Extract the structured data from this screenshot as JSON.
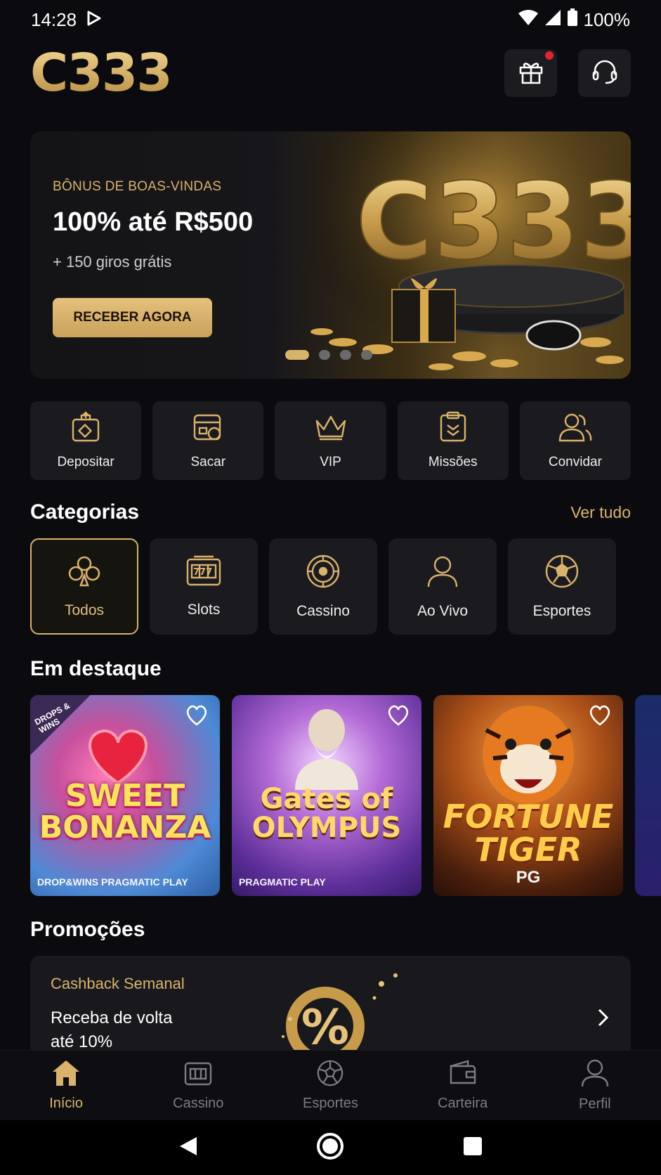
{
  "status_bar": {
    "time": "14:28",
    "battery": "100%"
  },
  "header": {
    "logo": "C333",
    "gift_icon": "gift-icon",
    "support_icon": "headset-icon"
  },
  "banner": {
    "eyebrow": "BÔNUS DE BOAS-VINDAS",
    "title": "100% até R$500",
    "subtitle": "+ 150 giros grátis",
    "cta": "RECEBER AGORA",
    "art_text": "C333",
    "slides": 4,
    "active_slide": 1
  },
  "quick_actions": [
    {
      "label": "Depositar",
      "icon": "deposit-icon"
    },
    {
      "label": "Sacar",
      "icon": "withdraw-icon"
    },
    {
      "label": "VIP",
      "icon": "crown-icon"
    },
    {
      "label": "Missões",
      "icon": "clipboard-icon"
    },
    {
      "label": "Convidar",
      "icon": "users-icon"
    }
  ],
  "categories": {
    "title": "Categorias",
    "see_all": "Ver tudo",
    "items": [
      {
        "label": "Todos",
        "icon": "club-icon",
        "selected": true
      },
      {
        "label": "Slots",
        "icon": "slot-machine-icon"
      },
      {
        "label": "Cassino",
        "icon": "roulette-icon"
      },
      {
        "label": "Ao Vivo",
        "icon": "person-icon"
      },
      {
        "label": "Esportes",
        "icon": "soccer-ball-icon"
      }
    ]
  },
  "featured": {
    "title": "Em destaque",
    "games": [
      {
        "name": "SWEET BONANZA",
        "badge": "DROPS & WINS",
        "provider": "DROP&WINS PRAGMATIC PLAY"
      },
      {
        "name": "Gates of OLYMPUS",
        "provider": "PRAGMATIC PLAY"
      },
      {
        "name": "FORTUNE TIGER",
        "provider": "PG"
      }
    ]
  },
  "promotions": {
    "title": "Promoções",
    "card": {
      "eyebrow": "Cashback Semanal",
      "title": "Receba de volta até 10%",
      "art": "%"
    }
  },
  "bottom_nav": [
    {
      "label": "Início",
      "icon": "home-icon",
      "active": true
    },
    {
      "label": "Cassino",
      "icon": "casino-icon"
    },
    {
      "label": "Esportes",
      "icon": "soccer-ball-icon"
    },
    {
      "label": "Carteira",
      "icon": "wallet-icon"
    },
    {
      "label": "Perfil",
      "icon": "profile-icon"
    }
  ],
  "colors": {
    "accent": "#d9b26c",
    "background": "#0b0b0f",
    "card": "#1b1b1f"
  }
}
